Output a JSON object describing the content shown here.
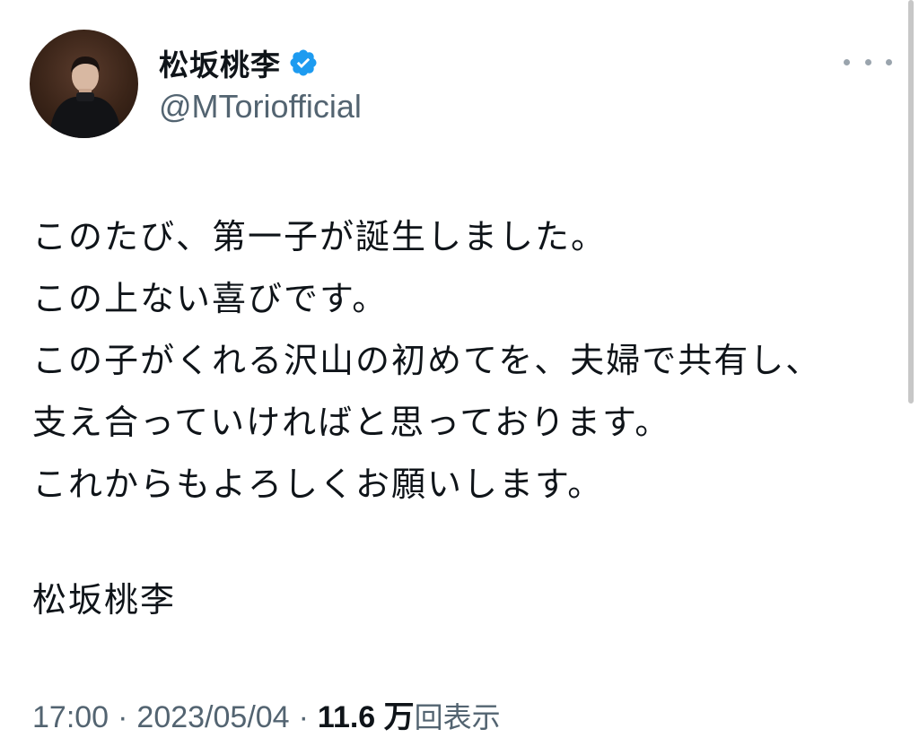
{
  "author": {
    "display_name": "松坂桃李",
    "handle": "@MTorio​fficial",
    "verified": true
  },
  "tweet": {
    "lines": [
      "このたび、第一子が誕生しました。",
      "この上ない喜びです。",
      "この子がくれる沢山の初めてを、夫婦で共有し、",
      "支え合っていければと思っております。",
      "これからもよろしくお願いします。"
    ],
    "signature": "松坂桃李"
  },
  "meta": {
    "time": "17:00",
    "separator": "·",
    "date": "2023/05/04",
    "views_count": "11.6 万",
    "views_label": "回表示"
  },
  "icons": {
    "more": "more-options-icon",
    "verified": "verified-badge-icon"
  },
  "colors": {
    "verified": "#1d9bf0",
    "text": "#0f1419",
    "secondary": "#536471"
  }
}
